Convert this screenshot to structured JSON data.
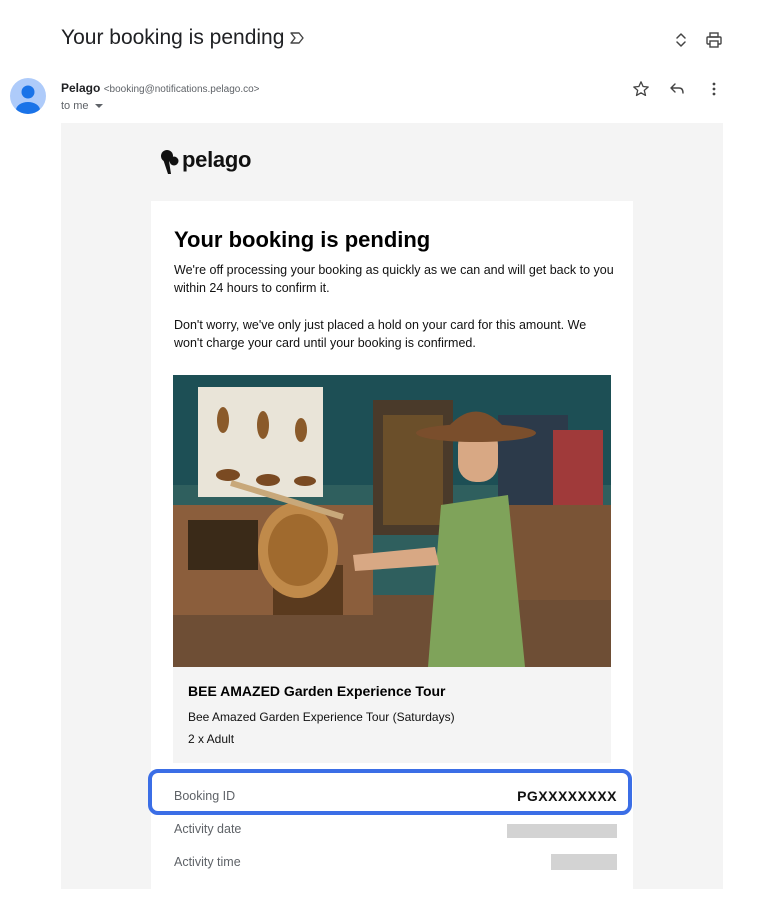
{
  "email": {
    "subject": "Your booking is pending",
    "sender_name": "Pelago",
    "sender_email": "<booking@notifications.pelago.co>",
    "recipient": "to me",
    "icons": [
      "label-important-icon",
      "expand-collapse-icon",
      "print-icon",
      "star-icon",
      "reply-icon",
      "more-vertical-icon",
      "chevron-down-icon"
    ]
  },
  "message": {
    "brand": "pelago",
    "heading": "Your booking is pending",
    "paragraph1": "We're off processing your booking as quickly as we can and will get back to you within 24 hours to confirm it.",
    "paragraph2": "Don't worry, we've only just placed a hold on your card for this amount. We won't charge your card until your booking is confirmed.",
    "product": {
      "title": "BEE AMAZED Garden Experience Tour",
      "option": "Bee Amazed Garden Experience Tour (Saturdays)",
      "quantity": "2 x Adult"
    },
    "details": {
      "booking_id_label": "Booking ID",
      "booking_id_value": "PGXXXXXXXX",
      "activity_date_label": "Activity date",
      "activity_time_label": "Activity time"
    }
  },
  "colors": {
    "highlight_border": "#3b6ee6",
    "canvas_bg": "#f4f4f4",
    "avatar": "#aecbfa"
  }
}
